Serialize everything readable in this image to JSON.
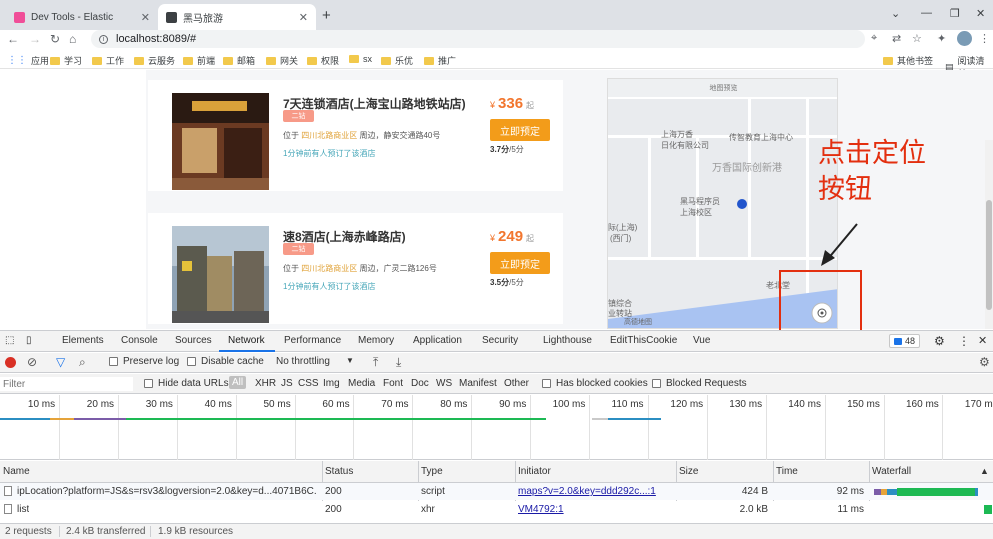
{
  "browser": {
    "tabs": [
      {
        "title": "Dev Tools - Elastic",
        "favicon_color": "#f04e98"
      },
      {
        "title": "黑马旅游",
        "favicon_color": "#3c4043"
      }
    ],
    "new_tab_icon": "plus-icon",
    "url": "localhost:8089/#",
    "bookmarks": [
      "应用",
      "学习",
      "工作",
      "云服务",
      "前端",
      "邮箱",
      "网关",
      "权限",
      "sx",
      "乐优",
      "推广"
    ],
    "other_bookmarks": "其他书签",
    "reading_list": "阅读清单"
  },
  "hotels": [
    {
      "name": "7天连锁酒店(上海宝山路地铁站店)",
      "tag": "二钻",
      "addr_prefix": "位于",
      "business_area": "四川北路商业区",
      "addr_suffix": "周边，静安交通路40号",
      "recent": "1分钟前有人预订了该酒店",
      "price_symbol": "¥",
      "price": "336",
      "price_suffix": "起",
      "book_label": "立即预定",
      "score": "3.7分",
      "score_total": "/5分"
    },
    {
      "name": "速8酒店(上海赤峰路店)",
      "tag": "二钻",
      "addr_prefix": "位于",
      "business_area": "四川北路商业区",
      "addr_suffix": "周边，广灵二路126号",
      "recent": "1分钟前有人预订了该酒店",
      "price_symbol": "¥",
      "price": "249",
      "price_suffix": "起",
      "book_label": "立即预定",
      "score": "3.5分",
      "score_total": "/5分"
    }
  ],
  "map": {
    "title": "地图预览",
    "labels": [
      "上海万香",
      "日化有限公司",
      "传智教育上海中心",
      "万香国际创新港",
      "黑马程序员",
      "上海校区",
      "际(上海)",
      "(西门)",
      "老北堂",
      "镇综合",
      "业转站",
      "高德地图"
    ]
  },
  "callout": {
    "line1": "点击定位",
    "line2": "按钮",
    "color": "#e32f0f"
  },
  "devtools": {
    "tabs": [
      "Elements",
      "Console",
      "Sources",
      "Network",
      "Performance",
      "Memory",
      "Application",
      "Security",
      "Lighthouse",
      "EditThisCookie",
      "Vue"
    ],
    "active_tab": "Network",
    "issues_count": "48",
    "toolbar": {
      "preserve_log": "Preserve log",
      "disable_cache": "Disable cache",
      "throttling": "No throttling"
    },
    "filter": {
      "placeholder": "Filter",
      "hide_data_urls": "Hide data URLs",
      "types": [
        "All",
        "XHR",
        "JS",
        "CSS",
        "Img",
        "Media",
        "Font",
        "Doc",
        "WS",
        "Manifest",
        "Other"
      ],
      "has_blocked_cookies": "Has blocked cookies",
      "blocked_requests": "Blocked Requests"
    },
    "timeline_labels": [
      "10 ms",
      "20 ms",
      "30 ms",
      "40 ms",
      "50 ms",
      "60 ms",
      "70 ms",
      "80 ms",
      "90 ms",
      "100 ms",
      "110 ms",
      "120 ms",
      "130 ms",
      "140 ms",
      "150 ms",
      "160 ms",
      "170 ms"
    ],
    "columns": [
      "Name",
      "Status",
      "Type",
      "Initiator",
      "Size",
      "Time",
      "Waterfall"
    ],
    "rows": [
      {
        "name": "ipLocation?platform=JS&s=rsv3&logversion=2.0&key=d...4071B6C...",
        "status": "200",
        "type": "script",
        "initiator": "maps?v=2.0&key=ddd292c...:1",
        "size": "424 B",
        "time": "92 ms"
      },
      {
        "name": "list",
        "status": "200",
        "type": "xhr",
        "initiator": "VM4792:1",
        "size": "2.0 kB",
        "time": "11 ms"
      }
    ],
    "status": {
      "requests": "2 requests",
      "transferred": "2.4 kB transferred",
      "resources": "1.9 kB resources"
    }
  }
}
